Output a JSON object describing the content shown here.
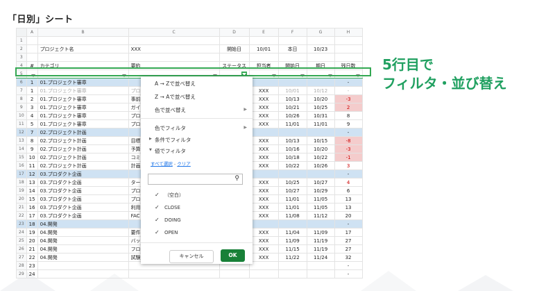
{
  "heading": "「日別」シート",
  "col_letters": [
    "A",
    "B",
    "C",
    "D",
    "E",
    "F",
    "G",
    "H"
  ],
  "rows": [
    {
      "n": "1",
      "type": "blank",
      "cells": [
        "",
        "",
        "",
        "",
        "",
        "",
        "",
        ""
      ]
    },
    {
      "n": "2",
      "type": "info",
      "cells": [
        "",
        "プロジェクト名",
        "XXX",
        "開始日",
        "10/01",
        "本日",
        "10/23",
        ""
      ]
    },
    {
      "n": "3",
      "type": "blank",
      "cells": [
        "",
        "",
        "",
        "",
        "",
        "",
        "",
        ""
      ]
    },
    {
      "n": "4",
      "type": "header",
      "cells": [
        "#",
        "カテゴリ",
        "要約",
        "ステータス",
        "担当者",
        "開始日",
        "期日",
        "残日数"
      ]
    },
    {
      "n": "5",
      "type": "filter",
      "cells": [
        "",
        "",
        "",
        "",
        "",
        "",
        "",
        ""
      ]
    },
    {
      "n": "6",
      "type": "group",
      "cells": [
        "1",
        "01.プロジェクト審章",
        "",
        "",
        "",
        "",
        "",
        "-"
      ]
    },
    {
      "n": "7",
      "type": "data",
      "grey": true,
      "cells": [
        "1",
        "01.プロジェクト審章",
        "プロ",
        "",
        "XXX",
        "10/01",
        "10/12",
        "-"
      ]
    },
    {
      "n": "8",
      "type": "data",
      "cells": [
        "2",
        "01.プロジェクト審章",
        "事前",
        "",
        "XXX",
        "10/13",
        "10/20",
        "-3"
      ],
      "neg": true
    },
    {
      "n": "9",
      "type": "data",
      "cells": [
        "3",
        "01.プロジェクト審章",
        "ガイ",
        "",
        "XXX",
        "10/21",
        "10/25",
        "2"
      ],
      "neg": true
    },
    {
      "n": "10",
      "type": "data",
      "cells": [
        "4",
        "01.プロジェクト審章",
        "プロ",
        "",
        "XXX",
        "10/26",
        "10/31",
        "8"
      ]
    },
    {
      "n": "11",
      "type": "data",
      "cells": [
        "5",
        "01.プロジェクト審章",
        "プロ",
        "",
        "XXX",
        "11/01",
        "11/01",
        "9"
      ]
    },
    {
      "n": "12",
      "type": "group",
      "cells": [
        "7",
        "02.プロジェクト計画",
        "",
        "",
        "",
        "",
        "",
        "-"
      ]
    },
    {
      "n": "13",
      "type": "data",
      "cells": [
        "8",
        "02.プロジェクト計画",
        "目標",
        "",
        "XXX",
        "10/13",
        "10/15",
        "-8"
      ],
      "neg": true
    },
    {
      "n": "14",
      "type": "data",
      "cells": [
        "9",
        "02.プロジェクト計画",
        "予算",
        "",
        "XXX",
        "10/16",
        "10/20",
        "-3"
      ],
      "neg": true
    },
    {
      "n": "15",
      "type": "data",
      "cells": [
        "10",
        "02.プロジェクト計画",
        "コミ",
        "",
        "XXX",
        "10/18",
        "10/22",
        "-1"
      ],
      "neg": true
    },
    {
      "n": "16",
      "type": "data",
      "cells": [
        "11",
        "02.プロジェクト計画",
        "計画",
        "",
        "XXX",
        "10/22",
        "10/26",
        "3"
      ],
      "redtxt": true
    },
    {
      "n": "17",
      "type": "group",
      "cells": [
        "12",
        "03.プロダクト企画",
        "",
        "",
        "",
        "",
        "",
        "-"
      ]
    },
    {
      "n": "18",
      "type": "data",
      "cells": [
        "13",
        "03.プロダクト企画",
        "ター",
        "",
        "XXX",
        "10/25",
        "10/27",
        "4"
      ],
      "redtxt": true
    },
    {
      "n": "19",
      "type": "data",
      "cells": [
        "14",
        "03.プロダクト企画",
        "プロ",
        "",
        "XXX",
        "10/27",
        "10/29",
        "6"
      ]
    },
    {
      "n": "20",
      "type": "data",
      "cells": [
        "15",
        "03.プロダクト企画",
        "プロ",
        "",
        "XXX",
        "11/01",
        "11/05",
        "13"
      ]
    },
    {
      "n": "21",
      "type": "data",
      "cells": [
        "16",
        "03.プロダクト企画",
        "利用",
        "",
        "XXX",
        "11/01",
        "11/05",
        "13"
      ]
    },
    {
      "n": "22",
      "type": "data",
      "cells": [
        "17",
        "03.プロダクト企画",
        "FAC",
        "",
        "XXX",
        "11/08",
        "11/12",
        "20"
      ]
    },
    {
      "n": "23",
      "type": "group",
      "cells": [
        "18",
        "04.開発",
        "",
        "",
        "",
        "",
        "",
        "-"
      ]
    },
    {
      "n": "24",
      "type": "data",
      "cells": [
        "19",
        "04.開発",
        "要件",
        "",
        "XXX",
        "11/04",
        "11/09",
        "17"
      ]
    },
    {
      "n": "25",
      "type": "data",
      "cells": [
        "20",
        "04.開発",
        "バッ",
        "",
        "XXX",
        "11/09",
        "11/19",
        "27"
      ]
    },
    {
      "n": "26",
      "type": "data",
      "cells": [
        "21",
        "04.開発",
        "フロ",
        "",
        "XXX",
        "11/15",
        "11/19",
        "27"
      ]
    },
    {
      "n": "27",
      "type": "data",
      "cells": [
        "22",
        "04.開発",
        "試験",
        "",
        "XXX",
        "11/22",
        "11/24",
        "32"
      ]
    },
    {
      "n": "28",
      "type": "data",
      "cells": [
        "23",
        "",
        "",
        "",
        "",
        "",
        "",
        "-"
      ]
    },
    {
      "n": "29",
      "type": "data",
      "cells": [
        "24",
        "",
        "",
        "",
        "",
        "",
        "",
        "-"
      ]
    }
  ],
  "menu": {
    "sort_az": "A → Zで並べ替え",
    "sort_za": "Z → Aで並べ替え",
    "sort_color": "色で並べ替え",
    "filter_color": "色でフィルタ",
    "filter_condition": "条件でフィルタ",
    "filter_values": "値でフィルタ",
    "select_all": "すべて選択",
    "separator": " - ",
    "clear": "クリア",
    "values": [
      "（空白）",
      "CLOSE",
      "DOING",
      "OPEN"
    ],
    "cancel": "キャンセル",
    "ok": "OK"
  },
  "callout": {
    "line1": "5行目で",
    "line2": "フィルタ・並び替え"
  },
  "colors": {
    "accent": "#34a853",
    "callout": "#20a060",
    "group_row": "#cfe2f3",
    "negative": "#f4cccc",
    "ok_button": "#188038"
  }
}
